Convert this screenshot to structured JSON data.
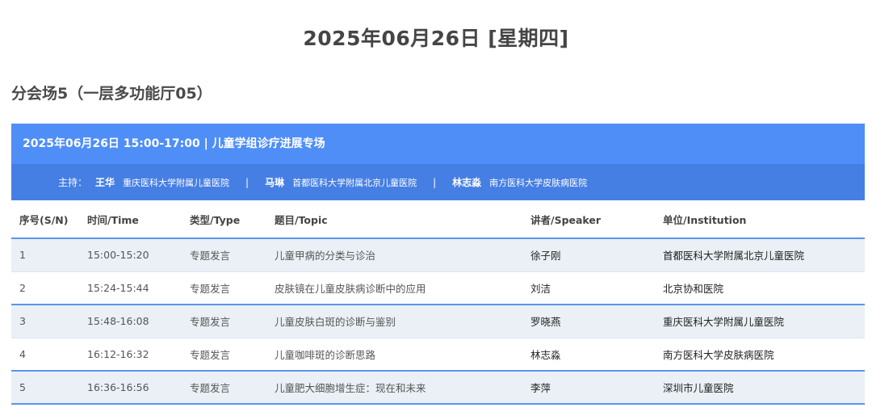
{
  "page": {
    "date_title": "2025年06月26日 [星期四]",
    "hall_title": "分会场5（一层多功能厅05）"
  },
  "session": {
    "title": "2025年06月26日 15:00-17:00 | 儿童学组诊疗进展专场",
    "host_label": "主持：",
    "hosts": [
      {
        "name": "王华",
        "institution": "重庆医科大学附属儿童医院"
      },
      {
        "name": "马琳",
        "institution": "首都医科大学附属北京儿童医院"
      },
      {
        "name": "林志淼",
        "institution": "南方医科大学皮肤病医院"
      }
    ],
    "separator": "|"
  },
  "table": {
    "headers": [
      "序号(S/N)",
      "时间/Time",
      "类型/Type",
      "题目/Topic",
      "讲者/Speaker",
      "单位/Institution"
    ],
    "rows": [
      {
        "sn": "1",
        "time": "15:00-15:20",
        "type": "专题发言",
        "topic": "儿童甲病的分类与诊治",
        "speaker": "徐子刚",
        "institution": "首都医科大学附属北京儿童医院"
      },
      {
        "sn": "2",
        "time": "15:24-15:44",
        "type": "专题发言",
        "topic": "皮肤镜在儿童皮肤病诊断中的应用",
        "speaker": "刘洁",
        "institution": "北京协和医院"
      },
      {
        "sn": "3",
        "time": "15:48-16:08",
        "type": "专题发言",
        "topic": "儿童皮肤白斑的诊断与鉴别",
        "speaker": "罗晓燕",
        "institution": "重庆医科大学附属儿童医院"
      },
      {
        "sn": "4",
        "time": "16:12-16:32",
        "type": "专题发言",
        "topic": "儿童咖啡斑的诊断思路",
        "speaker": "林志淼",
        "institution": "南方医科大学皮肤病医院"
      },
      {
        "sn": "5",
        "time": "16:36-16:56",
        "type": "专题发言",
        "topic": "儿童肥大细胞增生症：现在和未来",
        "speaker": "李萍",
        "institution": "深圳市儿童医院"
      }
    ]
  },
  "colors": {
    "header_blue": "#4f8ef7",
    "hosts_blue": "#467fe4",
    "row_stripe": "#eaf0f5",
    "divider_blue": "#5b93f0"
  }
}
